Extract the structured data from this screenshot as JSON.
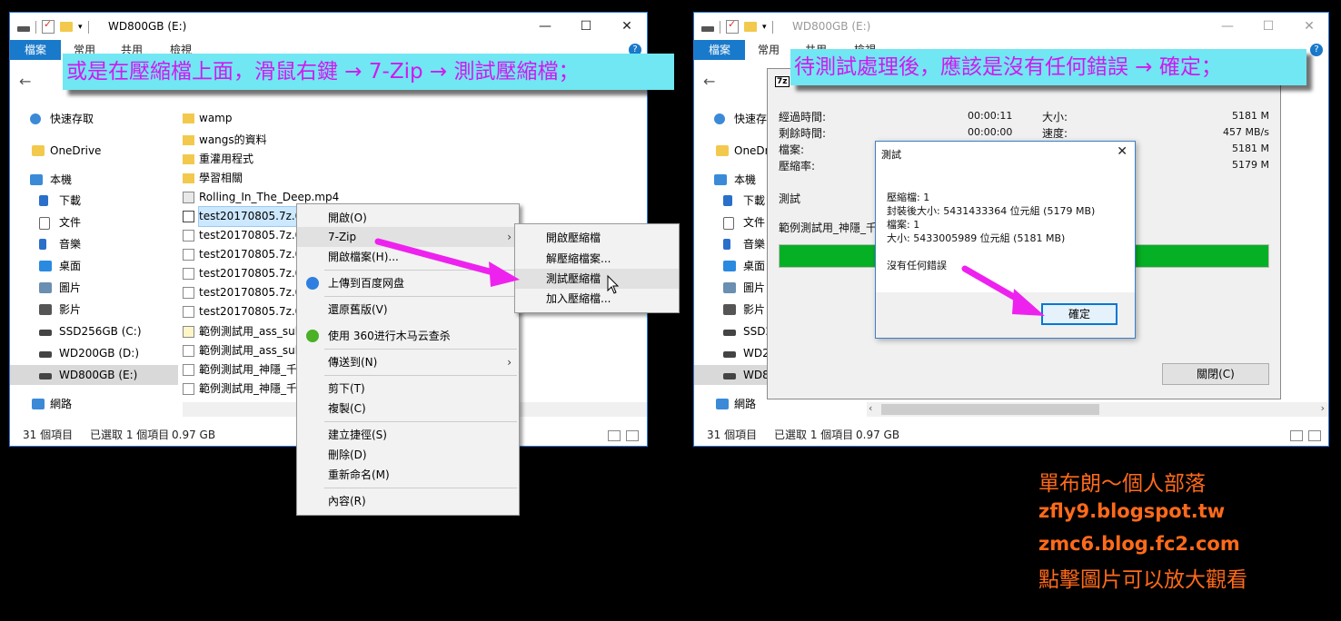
{
  "left_window": {
    "title": "WD800GB (E:)",
    "ribbon_tabs": [
      "檔案",
      "常用",
      "共用",
      "檢視"
    ],
    "nav": [
      {
        "label": "快速存取",
        "icon": "star-icon"
      },
      {
        "label": "OneDrive",
        "icon": "folder-icon"
      },
      {
        "label": "本機",
        "icon": "pc-icon"
      },
      {
        "label": "下載",
        "icon": "download-icon"
      },
      {
        "label": "文件",
        "icon": "document-icon"
      },
      {
        "label": "音樂",
        "icon": "music-icon"
      },
      {
        "label": "桌面",
        "icon": "desktop-icon"
      },
      {
        "label": "圖片",
        "icon": "pictures-icon"
      },
      {
        "label": "影片",
        "icon": "video-icon"
      },
      {
        "label": "SSD256GB (C:)",
        "icon": "drive-icon"
      },
      {
        "label": "WD200GB (D:)",
        "icon": "drive-icon"
      },
      {
        "label": "WD800GB (E:)",
        "icon": "drive-icon"
      },
      {
        "label": "網路",
        "icon": "network-icon"
      }
    ],
    "files": [
      {
        "name": "wamp",
        "type": "folder"
      },
      {
        "name": "wangs的資料",
        "type": "folder"
      },
      {
        "name": "重灌用程式",
        "type": "folder"
      },
      {
        "name": "學習相關",
        "type": "folder"
      },
      {
        "name": "Rolling_In_The_Deep.mp4",
        "type": "mp4"
      },
      {
        "name": "test20170805.7z.001",
        "type": "z"
      },
      {
        "name": "test20170805.7z.002",
        "type": "doc"
      },
      {
        "name": "test20170805.7z.003",
        "type": "doc"
      },
      {
        "name": "test20170805.7z.004",
        "type": "doc"
      },
      {
        "name": "test20170805.7z.005",
        "type": "doc"
      },
      {
        "name": "test20170805.7z.006",
        "type": "doc"
      },
      {
        "name": "範例測試用_ass_subtitle",
        "type": "ass"
      },
      {
        "name": "範例測試用_ass_subtitle",
        "type": "doc"
      },
      {
        "name": "範例測試用_神隱_千與千尋",
        "type": "doc"
      },
      {
        "name": "範例測試用_神隱_千與千尋",
        "type": "doc"
      }
    ],
    "status": {
      "items": "31 個項目",
      "selected": "已選取 1 個項目",
      "size": "0.97 GB"
    }
  },
  "context_menu": {
    "items": [
      {
        "label": "開啟(O)",
        "icon": ""
      },
      {
        "label": "7-Zip",
        "icon": "",
        "submenu": true
      },
      {
        "label": "開啟檔案(H)...",
        "icon": ""
      },
      {
        "label": "上傳到百度网盘",
        "icon": "baidu-cloud-icon"
      },
      {
        "label": "還原舊版(V)",
        "icon": ""
      },
      {
        "label": "使用 360进行木马云查杀",
        "icon": "360-shield-icon"
      },
      {
        "label": "傳送到(N)",
        "icon": "",
        "submenu": true
      },
      {
        "label": "剪下(T)",
        "icon": ""
      },
      {
        "label": "複製(C)",
        "icon": ""
      },
      {
        "label": "建立捷徑(S)",
        "icon": ""
      },
      {
        "label": "刪除(D)",
        "icon": ""
      },
      {
        "label": "重新命名(M)",
        "icon": ""
      },
      {
        "label": "內容(R)",
        "icon": ""
      }
    ]
  },
  "submenu_7zip": {
    "items": [
      "開啟壓縮檔",
      "解壓縮檔案...",
      "測試壓縮檔",
      "加入壓縮檔..."
    ]
  },
  "callout_left": "或是在壓縮檔上面，滑鼠右鍵 → 7-Zip → 測試壓縮檔；",
  "right_window": {
    "title": "WD800GB (E:)",
    "ribbon_tabs": [
      "檔案",
      "常用",
      "共用",
      "檢視"
    ],
    "nav": [
      "快速存取",
      "OneDr",
      "本機",
      "下載",
      "文件",
      "音樂",
      "桌面",
      "圖片",
      "影片",
      "SSD2",
      "WD2",
      "WD8",
      "網路"
    ],
    "status": {
      "items": "31 個項目",
      "selected": "已選取 1 個項目",
      "size": "0.97 GB"
    }
  },
  "callout_right": "待測試處理後，應該是沒有任何錯誤 → 確定；",
  "zip_dialog": {
    "logo": "7z",
    "elapsed_label": "經過時間:",
    "elapsed": "00:00:11",
    "remaining_label": "剩餘時間:",
    "remaining": "00:00:00",
    "files_label": "檔案:",
    "ratio_label": "壓縮率:",
    "size_label": "大小:",
    "size": "5181 M",
    "speed_label": "速度:",
    "speed": "457 MB/s",
    "processed": "5181 M",
    "packed": "5179 M",
    "action": "測試",
    "current_file": "範例測試用_神隱_千",
    "progress": 1.0,
    "close_button": "關閉(C)"
  },
  "msgbox": {
    "title": "測試",
    "lines": [
      "壓縮檔: 1",
      "封裝後大小: 5431433364 位元組 (5179 MB)",
      "檔案: 1",
      "大小: 5433005989 位元組 (5181 MB)"
    ],
    "result": "沒有任何錯誤",
    "ok": "確定"
  },
  "credits": {
    "line1": "單布朗～個人部落",
    "line2": "zfly9.blogspot.tw",
    "line3": "zmc6.blog.fc2.com",
    "line4": "點擊圖片可以放大觀看"
  },
  "colors": {
    "accent": "#1979ca",
    "callout_bg": "#70e7f2",
    "callout_text": "#d218f0",
    "arrow": "#ee22ee",
    "progress": "#06b025",
    "credit": "#ff6a1a"
  }
}
